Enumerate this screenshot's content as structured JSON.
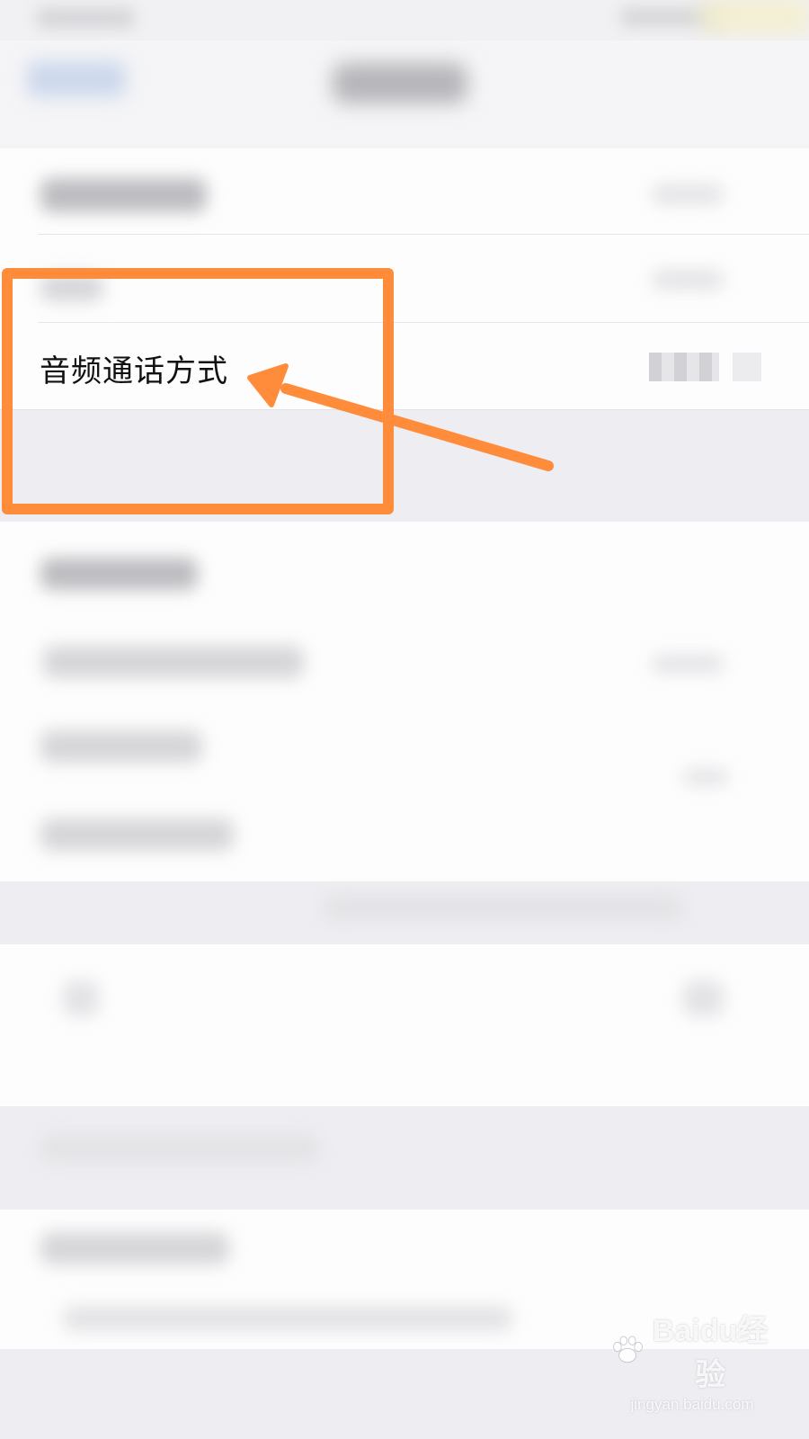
{
  "settings_row": {
    "label": "音频通话方式"
  },
  "watermark": {
    "brand": "Baidu经验",
    "url": "jingyan.baidu.com"
  },
  "colors": {
    "annotation": "#ff8c3a",
    "background": "#f4f4f6",
    "card": "#fdfdfd"
  }
}
